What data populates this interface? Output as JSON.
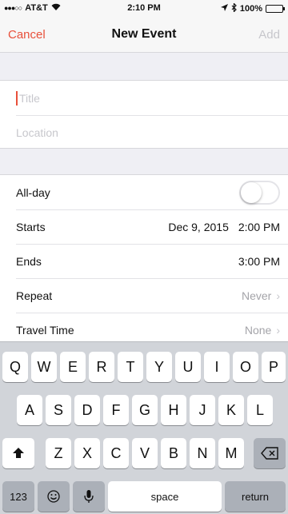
{
  "status_bar": {
    "signal": "●●●○○",
    "carrier": "AT&T",
    "wifi": "wifi-icon",
    "time": "2:10 PM",
    "battery": "100%"
  },
  "nav": {
    "cancel": "Cancel",
    "title": "New Event",
    "add": "Add"
  },
  "form": {
    "title_placeholder": "Title",
    "location_placeholder": "Location",
    "all_day_label": "All-day",
    "all_day_on": false,
    "starts_label": "Starts",
    "starts_date": "Dec 9, 2015",
    "starts_time": "2:00 PM",
    "ends_label": "Ends",
    "ends_time": "3:00 PM",
    "repeat_label": "Repeat",
    "repeat_value": "Never",
    "travel_label": "Travel Time",
    "travel_value": "None"
  },
  "keyboard": {
    "row1": [
      "Q",
      "W",
      "E",
      "R",
      "T",
      "Y",
      "U",
      "I",
      "O",
      "P"
    ],
    "row2": [
      "A",
      "S",
      "D",
      "F",
      "G",
      "H",
      "J",
      "K",
      "L"
    ],
    "row3": [
      "Z",
      "X",
      "C",
      "V",
      "B",
      "N",
      "M"
    ],
    "numbers": "123",
    "space": "space",
    "return": "return"
  },
  "colors": {
    "accent": "#e8503a",
    "background": "#efeff4"
  }
}
